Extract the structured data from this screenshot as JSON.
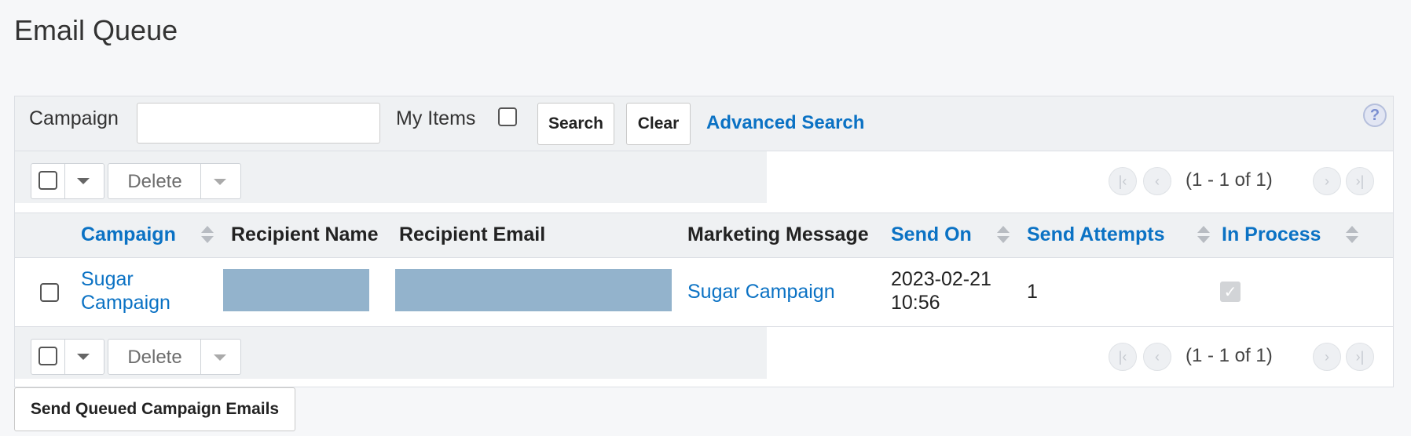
{
  "page": {
    "title": "Email Queue"
  },
  "search": {
    "campaign_label": "Campaign",
    "campaign_value": "",
    "my_items_label": "My Items",
    "search_button": "Search",
    "clear_button": "Clear",
    "advanced_search": "Advanced Search",
    "help_icon": "?"
  },
  "actions": {
    "delete_label": "Delete",
    "pagination": "(1 - 1 of 1)"
  },
  "table": {
    "columns": [
      {
        "label": "Campaign",
        "sortable": true
      },
      {
        "label": "Recipient Name",
        "sortable": false
      },
      {
        "label": "Recipient Email",
        "sortable": false
      },
      {
        "label": "Marketing Message",
        "sortable": false
      },
      {
        "label": "Send On",
        "sortable": true
      },
      {
        "label": "Send Attempts",
        "sortable": true
      },
      {
        "label": "In Process",
        "sortable": true
      }
    ],
    "rows": [
      {
        "campaign_line1": "Sugar",
        "campaign_line2": "Campaign",
        "recipient_name": "",
        "recipient_email": "",
        "marketing_message": "Sugar Campaign",
        "send_on_date": "2023-02-21",
        "send_on_time": "10:56",
        "send_attempts": "1",
        "in_process": true
      }
    ]
  },
  "footer": {
    "send_button": "Send Queued Campaign Emails"
  },
  "colors": {
    "link": "#0b72c4",
    "redaction": "#93b3cc",
    "panel_bg": "#eff1f3"
  }
}
